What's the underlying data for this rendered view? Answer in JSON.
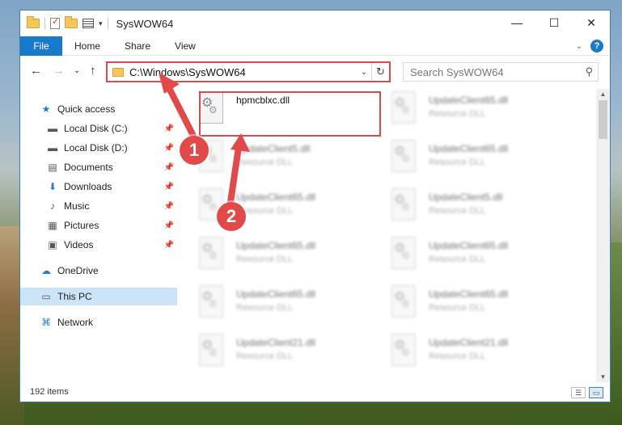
{
  "window": {
    "title": "SysWOW64",
    "minimize_glyph": "—",
    "maximize_glyph": "☐",
    "close_glyph": "✕"
  },
  "ribbon": {
    "tabs": [
      {
        "label": "File"
      },
      {
        "label": "Home"
      },
      {
        "label": "Share"
      },
      {
        "label": "View"
      }
    ],
    "expand_glyph": "⌄",
    "help_glyph": "?"
  },
  "navigation": {
    "back_glyph": "←",
    "forward_glyph": "→",
    "recent_glyph": "⌄",
    "up_glyph": "↑",
    "address_path": "C:\\Windows\\SysWOW64",
    "address_dropdown_glyph": "⌄",
    "refresh_glyph": "↻",
    "search_placeholder": "Search SysWOW64",
    "search_glyph": "⚲"
  },
  "sidebar": {
    "items": [
      {
        "label": "Quick access",
        "icon": "star-icon",
        "glyph": "★",
        "pinned": false
      },
      {
        "label": "Local Disk (C:)",
        "icon": "drive-icon",
        "glyph": "▬",
        "pinned": true
      },
      {
        "label": "Local Disk (D:)",
        "icon": "drive-icon",
        "glyph": "▬",
        "pinned": true
      },
      {
        "label": "Documents",
        "icon": "documents-icon",
        "glyph": "▤",
        "pinned": true
      },
      {
        "label": "Downloads",
        "icon": "download-icon",
        "glyph": "⬇",
        "pinned": true
      },
      {
        "label": "Music",
        "icon": "music-icon",
        "glyph": "♪",
        "pinned": true
      },
      {
        "label": "Pictures",
        "icon": "pictures-icon",
        "glyph": "▦",
        "pinned": true
      },
      {
        "label": "Videos",
        "icon": "videos-icon",
        "glyph": "▣",
        "pinned": true
      },
      {
        "label": "OneDrive",
        "icon": "cloud-icon",
        "glyph": "☁",
        "pinned": false
      },
      {
        "label": "This PC",
        "icon": "computer-icon",
        "glyph": "▭",
        "pinned": false,
        "selected": true
      },
      {
        "label": "Network",
        "icon": "network-icon",
        "glyph": "⌘",
        "pinned": false
      }
    ],
    "pin_glyph": "📌"
  },
  "files": {
    "highlighted": {
      "name": "hpmcblxc.dll"
    },
    "background": [
      {
        "name": "UpdateClient65.dll",
        "type": "Resource DLL"
      },
      {
        "name": "UpdateClient5.dll",
        "type": "Resource DLL"
      },
      {
        "name": "UpdateClient65.dll",
        "type": "Resource DLL"
      },
      {
        "name": "UpdateClient65.dll",
        "type": "Resource DLL"
      },
      {
        "name": "UpdateClient5.dll",
        "type": "Resource DLL"
      },
      {
        "name": "UpdateClient65.dll",
        "type": "Resource DLL"
      },
      {
        "name": "UpdateClient65.dll",
        "type": "Resource DLL"
      },
      {
        "name": "UpdateClient65.dll",
        "type": "Resource DLL"
      },
      {
        "name": "UpdateClient65.dll",
        "type": "Resource DLL"
      },
      {
        "name": "UpdateClient21.dll",
        "type": "Resource DLL"
      },
      {
        "name": "UpdateClient21.dll",
        "type": "Resource DLL"
      }
    ]
  },
  "status": {
    "item_count": "192 items"
  },
  "annotations": {
    "step1": "1",
    "step2": "2",
    "color": "#e24a4a"
  }
}
